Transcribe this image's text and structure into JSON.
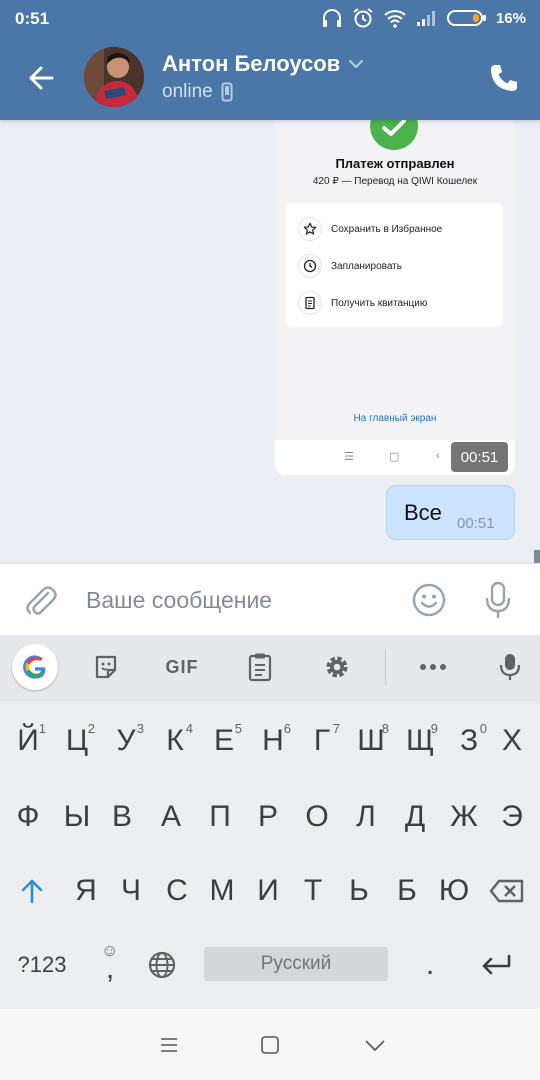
{
  "status_bar": {
    "time": "0:51",
    "battery_percent": "16%"
  },
  "header": {
    "name": "Антон Белоусов",
    "status": "online"
  },
  "payment": {
    "title": "Платеж отправлен",
    "subtitle": "420 ₽ — Перевод на QIWI Кошелек",
    "options": [
      {
        "label": "Сохранить в Избранное",
        "icon": "star-icon"
      },
      {
        "label": "Запланировать",
        "icon": "clock-icon"
      },
      {
        "label": "Получить квитанцию",
        "icon": "receipt-icon"
      }
    ],
    "home_link": "На главный экран",
    "message_time": "00:51"
  },
  "outgoing": {
    "text": "Все",
    "time": "00:51"
  },
  "composer": {
    "placeholder": "Ваше сообщение"
  },
  "keyboard": {
    "toolbar": {
      "gif": "GIF"
    },
    "row1": [
      {
        "l": "Й",
        "h": "1"
      },
      {
        "l": "Ц",
        "h": "2"
      },
      {
        "l": "У",
        "h": "3"
      },
      {
        "l": "К",
        "h": "4"
      },
      {
        "l": "Е",
        "h": "5"
      },
      {
        "l": "Н",
        "h": "6"
      },
      {
        "l": "Г",
        "h": "7"
      },
      {
        "l": "Ш",
        "h": "8"
      },
      {
        "l": "Щ",
        "h": "9"
      },
      {
        "l": "З",
        "h": "0"
      },
      {
        "l": "Х",
        "h": ""
      }
    ],
    "row2": [
      "Ф",
      "Ы",
      "В",
      "А",
      "П",
      "Р",
      "О",
      "Л",
      "Д",
      "Ж",
      "Э"
    ],
    "row3": [
      "Я",
      "Ч",
      "С",
      "М",
      "И",
      "Т",
      "Ь",
      "Б",
      "Ю"
    ],
    "symbols_label": "?123",
    "comma": ",",
    "space_label": "Русский",
    "period": "."
  },
  "colors": {
    "header": "#4a76a8",
    "outgoing_bubble": "#cce4ff",
    "success": "#4bb34b",
    "link": "#2b71c4"
  }
}
